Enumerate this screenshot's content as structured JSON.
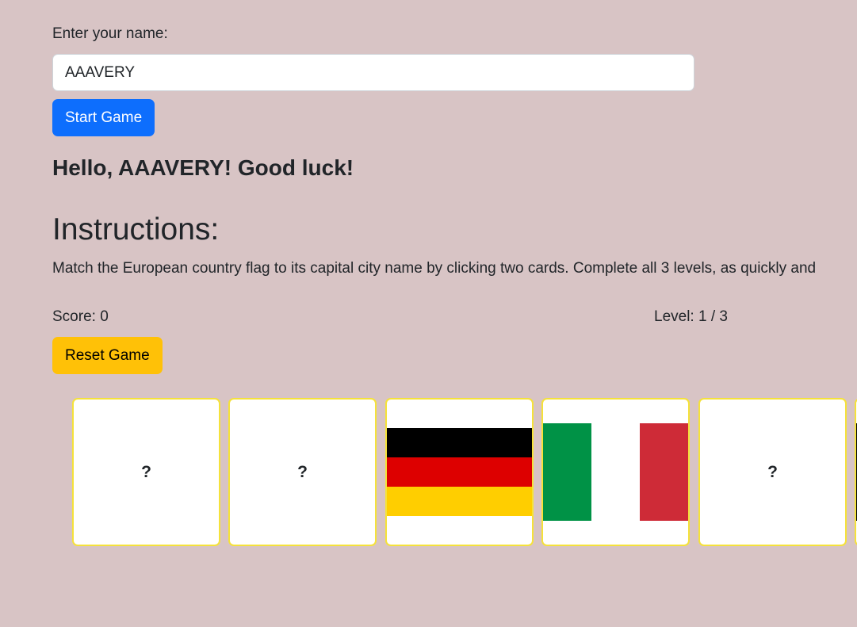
{
  "form": {
    "name_label": "Enter your name:",
    "name_value": "AAAVERY",
    "start_label": "Start Game"
  },
  "greeting": "Hello, AAAVERY! Good luck!",
  "instructions": {
    "title": "Instructions:",
    "text": "Match the European country flag to its capital city name by clicking two cards. Complete all 3 levels, as quickly and"
  },
  "status": {
    "score": "Score: 0",
    "level": "Level: 1 / 3"
  },
  "reset_label": "Reset Game",
  "cards": [
    {
      "type": "hidden",
      "label": "?"
    },
    {
      "type": "hidden",
      "label": "?"
    },
    {
      "type": "flag",
      "flag": "germany",
      "colors": [
        "#000000",
        "#dd0000",
        "#ffce00"
      ]
    },
    {
      "type": "flag",
      "flag": "italy",
      "colors": [
        "#009246",
        "#ffffff",
        "#ce2b37"
      ]
    },
    {
      "type": "hidden",
      "label": "?"
    }
  ],
  "colors": {
    "background": "#d8c4c5",
    "primary": "#0d6efd",
    "warning": "#ffc107",
    "card_border": "#f5e23a"
  }
}
